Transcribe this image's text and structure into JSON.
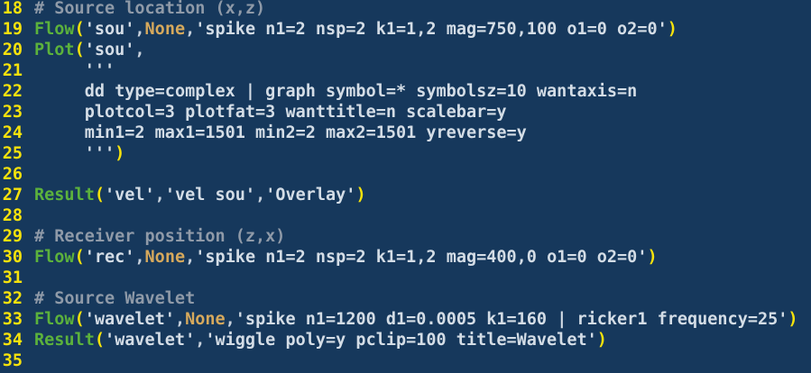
{
  "colors": {
    "background": "#16385c",
    "line_number": "#f6e20c",
    "comment": "#8f9aa8",
    "function": "#5cb23c",
    "string": "#d4dde6",
    "constant": "#d6a95c",
    "paren": "#f6e20c",
    "plain": "#c7d1dc"
  },
  "lines": [
    {
      "num": "18",
      "tokens": [
        {
          "t": "comment",
          "v": "# Source location (x,z)"
        }
      ]
    },
    {
      "num": "19",
      "tokens": [
        {
          "t": "func",
          "v": "Flow"
        },
        {
          "t": "paren",
          "v": "("
        },
        {
          "t": "str",
          "v": "'sou'"
        },
        {
          "t": "punct",
          "v": ","
        },
        {
          "t": "const",
          "v": "None"
        },
        {
          "t": "punct",
          "v": ","
        },
        {
          "t": "str",
          "v": "'spike n1=2 nsp=2 k1=1,2 mag=750,100 o1=0 o2=0'"
        },
        {
          "t": "paren",
          "v": ")"
        }
      ]
    },
    {
      "num": "20",
      "tokens": [
        {
          "t": "func",
          "v": "Plot"
        },
        {
          "t": "paren",
          "v": "("
        },
        {
          "t": "str",
          "v": "'sou'"
        },
        {
          "t": "punct",
          "v": ","
        }
      ]
    },
    {
      "num": "21",
      "tokens": [
        {
          "t": "plain",
          "v": "     "
        },
        {
          "t": "str",
          "v": "'''"
        }
      ]
    },
    {
      "num": "22",
      "tokens": [
        {
          "t": "plain",
          "v": "     "
        },
        {
          "t": "str",
          "v": "dd type=complex | graph symbol=* symbolsz=10 wantaxis=n"
        }
      ]
    },
    {
      "num": "23",
      "tokens": [
        {
          "t": "plain",
          "v": "     "
        },
        {
          "t": "str",
          "v": "plotcol=3 plotfat=3 wanttitle=n scalebar=y"
        }
      ]
    },
    {
      "num": "24",
      "tokens": [
        {
          "t": "plain",
          "v": "     "
        },
        {
          "t": "str",
          "v": "min1=2 max1=1501 min2=2 max2=1501 yreverse=y"
        }
      ]
    },
    {
      "num": "25",
      "tokens": [
        {
          "t": "plain",
          "v": "     "
        },
        {
          "t": "str",
          "v": "'''"
        },
        {
          "t": "paren",
          "v": ")"
        }
      ]
    },
    {
      "num": "26",
      "tokens": []
    },
    {
      "num": "27",
      "tokens": [
        {
          "t": "func",
          "v": "Result"
        },
        {
          "t": "paren",
          "v": "("
        },
        {
          "t": "str",
          "v": "'vel'"
        },
        {
          "t": "punct",
          "v": ","
        },
        {
          "t": "str",
          "v": "'vel sou'"
        },
        {
          "t": "punct",
          "v": ","
        },
        {
          "t": "str",
          "v": "'Overlay'"
        },
        {
          "t": "paren",
          "v": ")"
        }
      ]
    },
    {
      "num": "28",
      "tokens": []
    },
    {
      "num": "29",
      "tokens": [
        {
          "t": "comment",
          "v": "# Receiver position (z,x)"
        }
      ]
    },
    {
      "num": "30",
      "tokens": [
        {
          "t": "func",
          "v": "Flow"
        },
        {
          "t": "paren",
          "v": "("
        },
        {
          "t": "str",
          "v": "'rec'"
        },
        {
          "t": "punct",
          "v": ","
        },
        {
          "t": "const",
          "v": "None"
        },
        {
          "t": "punct",
          "v": ","
        },
        {
          "t": "str",
          "v": "'spike n1=2 nsp=2 k1=1,2 mag=400,0 o1=0 o2=0'"
        },
        {
          "t": "paren",
          "v": ")"
        }
      ]
    },
    {
      "num": "31",
      "tokens": []
    },
    {
      "num": "32",
      "tokens": [
        {
          "t": "comment",
          "v": "# Source Wavelet"
        }
      ]
    },
    {
      "num": "33",
      "tokens": [
        {
          "t": "func",
          "v": "Flow"
        },
        {
          "t": "paren",
          "v": "("
        },
        {
          "t": "str",
          "v": "'wavelet'"
        },
        {
          "t": "punct",
          "v": ","
        },
        {
          "t": "const",
          "v": "None"
        },
        {
          "t": "punct",
          "v": ","
        },
        {
          "t": "str",
          "v": "'spike n1=1200 d1=0.0005 k1=160 | ricker1 frequency=25'"
        },
        {
          "t": "paren",
          "v": ")"
        }
      ]
    },
    {
      "num": "34",
      "tokens": [
        {
          "t": "func",
          "v": "Result"
        },
        {
          "t": "paren",
          "v": "("
        },
        {
          "t": "str",
          "v": "'wavelet'"
        },
        {
          "t": "punct",
          "v": ","
        },
        {
          "t": "str",
          "v": "'wiggle poly=y pclip=100 title=Wavelet'"
        },
        {
          "t": "paren",
          "v": ")"
        }
      ]
    },
    {
      "num": "35",
      "tokens": []
    }
  ]
}
